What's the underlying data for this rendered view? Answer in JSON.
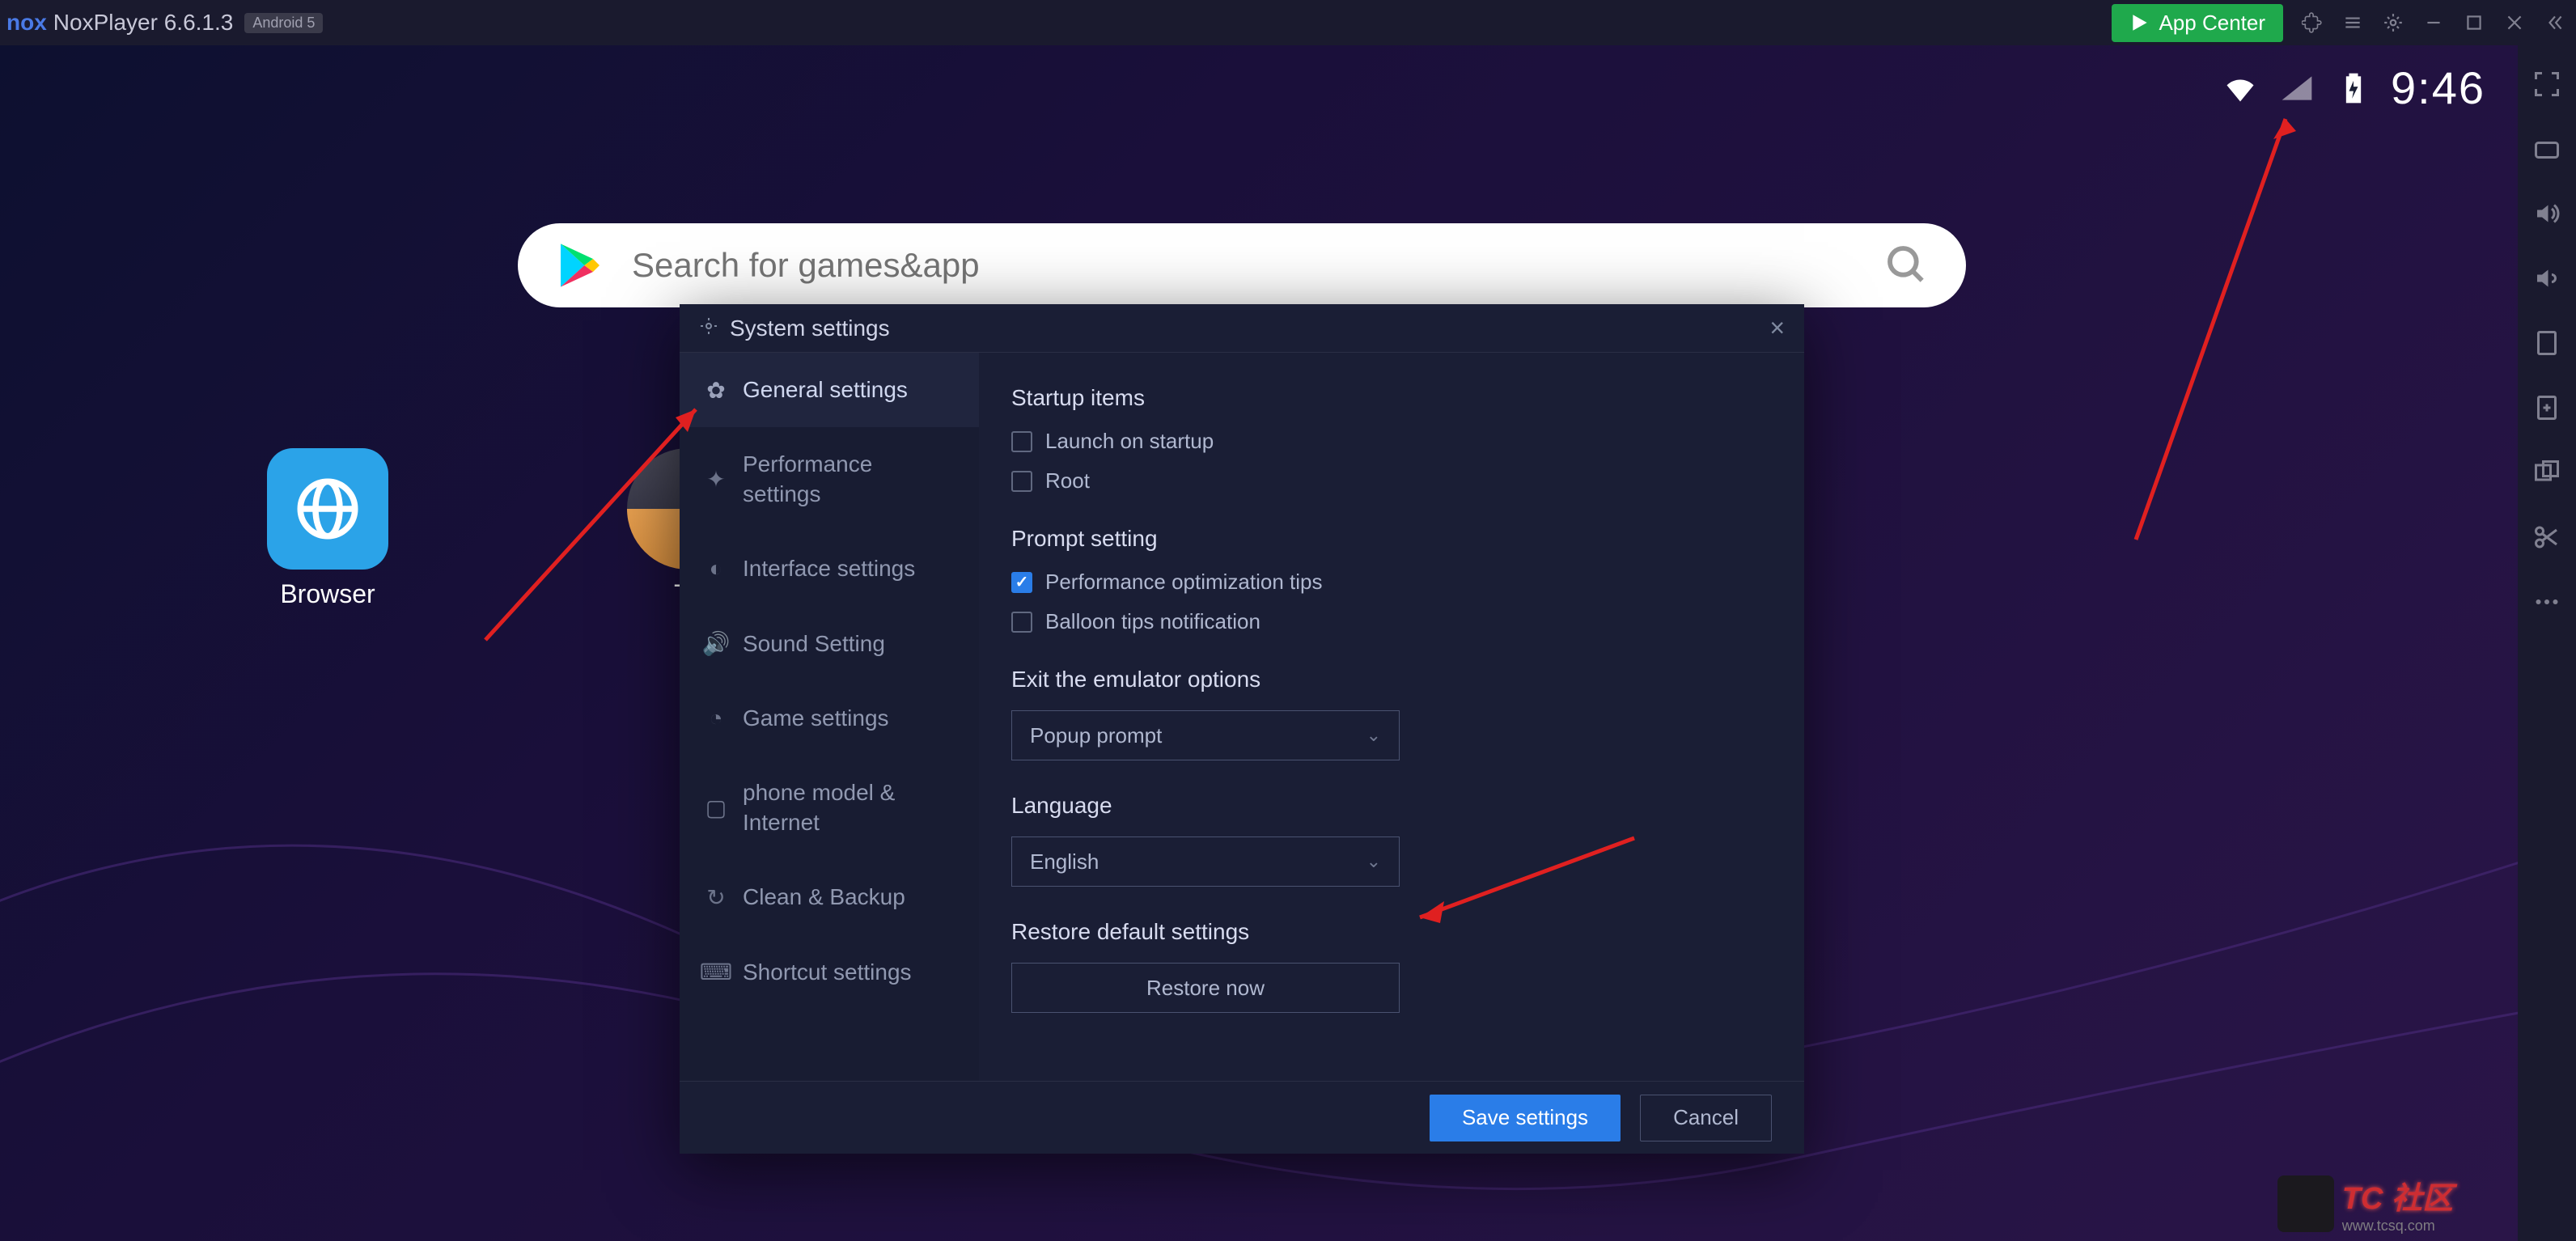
{
  "titlebar": {
    "app_name": "NoxPlayer 6.6.1.3",
    "android_badge": "Android 5",
    "app_center": "App Center"
  },
  "statusbar": {
    "time": "9:46"
  },
  "search": {
    "placeholder": "Search for games&app"
  },
  "desktop": {
    "browser_label": "Browser",
    "tools_label": "To"
  },
  "modal": {
    "title": "System settings",
    "sidebar": [
      "General settings",
      "Performance settings",
      "Interface settings",
      "Sound Setting",
      "Game settings",
      "phone model & Internet",
      "Clean & Backup",
      "Shortcut settings"
    ],
    "sections": {
      "startup_title": "Startup items",
      "launch_startup": "Launch on startup",
      "root": "Root",
      "prompt_title": "Prompt setting",
      "perf_tips": "Performance optimization tips",
      "balloon_tips": "Balloon tips notification",
      "exit_title": "Exit the emulator options",
      "exit_value": "Popup prompt",
      "lang_title": "Language",
      "lang_value": "English",
      "restore_title": "Restore default settings",
      "restore_btn": "Restore now"
    },
    "footer": {
      "save": "Save settings",
      "cancel": "Cancel"
    }
  },
  "watermark": {
    "main": "TC 社区",
    "sub": "www.tcsq.com"
  }
}
